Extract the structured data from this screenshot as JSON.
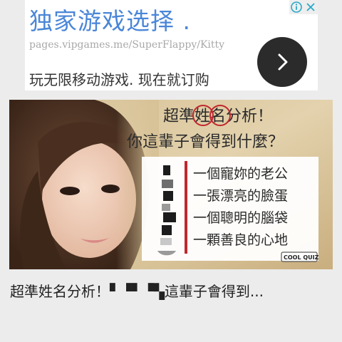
{
  "ad": {
    "headline": "独家游戏选择 .",
    "url": "pages.vipgames.me/SuperFlappy/Kitty",
    "cta": "玩无限移动游戏. 现在就订购",
    "go_icon": "chevron-right-icon",
    "info_icon": "info-icon",
    "close_icon": "close-icon",
    "accent_color": "#4a86d8"
  },
  "article": {
    "image": {
      "title_line1_pre": "超準",
      "title_circle1": "姓",
      "title_circle2": "名",
      "title_line1_post": "分析！",
      "title_line2": "你這輩子會得到什麼？",
      "results": [
        "一個寵妳的老公",
        "一張漂亮的臉蛋",
        "一個聰明的腦袋",
        "一顆善良的心地"
      ],
      "logo": "COOL QUIZ"
    },
    "title": "超準姓名分析！▘▝▘▝▚這輩子會得到..."
  }
}
